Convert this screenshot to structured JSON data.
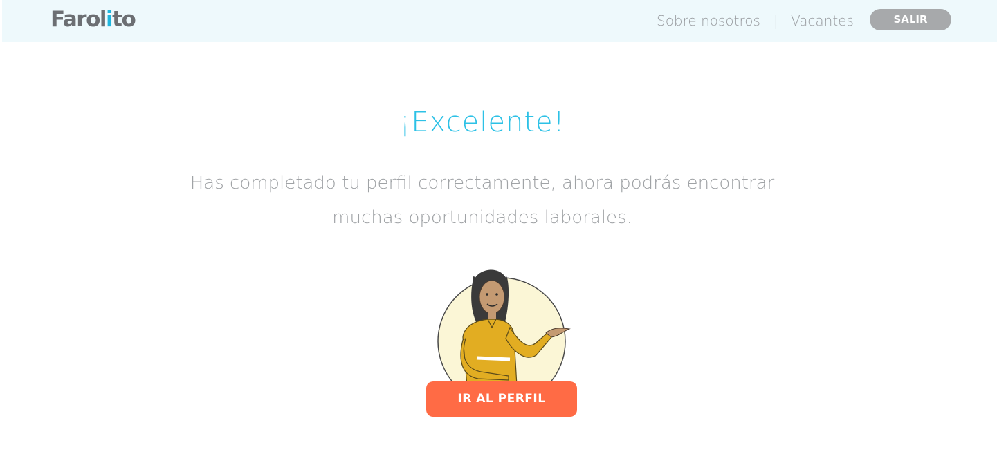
{
  "header": {
    "logo_prefix": "Farol",
    "logo_accent": "i",
    "logo_suffix": "to",
    "nav_about": "Sobre nosotros",
    "nav_separator": "|",
    "nav_jobs": "Vacantes",
    "logout_label": "SALIR"
  },
  "main": {
    "title": "¡Excelente!",
    "message": "Has completado tu perfil correctamente, ahora podrás encontrar muchas oportunidades laborales.",
    "illustration_icon": "woman-presenting-icon",
    "cta_label": "IR AL PERFIL"
  },
  "colors": {
    "header_bg": "#eef9fc",
    "title": "#2dc1e6",
    "text": "#a0a3a6",
    "cta": "#ff6b45",
    "logout": "#a7a9ab"
  }
}
